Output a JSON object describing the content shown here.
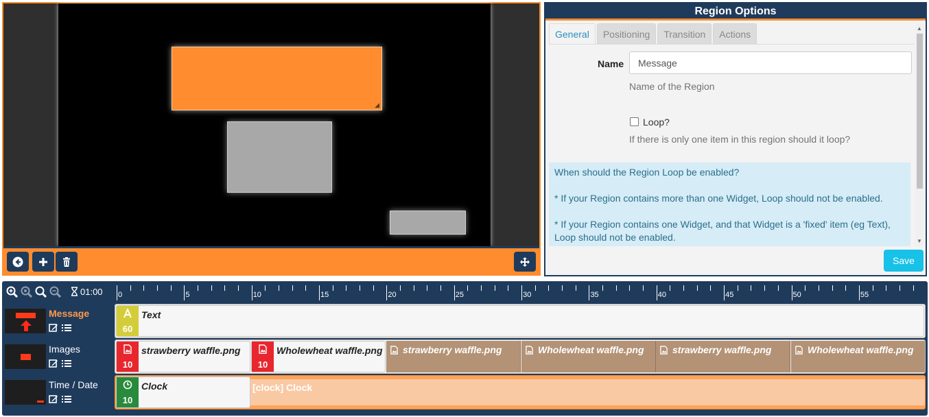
{
  "region_options": {
    "title": "Region Options",
    "tabs": [
      {
        "label": "General"
      },
      {
        "label": "Positioning"
      },
      {
        "label": "Transition"
      },
      {
        "label": "Actions"
      }
    ],
    "name_label": "Name",
    "name_value": "Message",
    "name_help": "Name of the Region",
    "loop_label": "Loop?",
    "loop_help": "If there is only one item in this region should it loop?",
    "info": [
      "When should the Region Loop be enabled?",
      "* If your Region contains more than one Widget, Loop should not be enabled.",
      "* If your Region contains one Widget, and that Widget is a 'fixed' item (eg Text), Loop should not be enabled."
    ],
    "save_label": "Save"
  },
  "colors": {
    "accent": "#ff8c2e",
    "navy": "#1f3b5c",
    "save": "#17c1e8",
    "text_widget": "#d4cd3a",
    "image_widget": "#e8262e",
    "clock_widget": "#2a8a3c"
  },
  "timeline": {
    "duration": "01:00",
    "tick_labels": [
      "0",
      "5",
      "10",
      "15",
      "20",
      "25",
      "30",
      "35",
      "40",
      "45",
      "50",
      "55"
    ],
    "rows": [
      {
        "name": "Message",
        "widgets": [
          {
            "label": "Text",
            "duration": "60",
            "icon": "text-a-icon"
          }
        ]
      },
      {
        "name": "Images",
        "widgets": [
          {
            "label": "strawberry waffle.png",
            "duration": "10",
            "icon": "image-icon"
          },
          {
            "label": "Wholewheat waffle.png",
            "duration": "10",
            "icon": "image-icon"
          }
        ],
        "loop_preview": [
          "strawberry waffle.png",
          "Wholewheat waffle.png",
          "strawberry waffle.png",
          "Wholewheat waffle.png"
        ]
      },
      {
        "name": "Time / Date",
        "widgets": [
          {
            "label": "Clock",
            "duration": "10",
            "icon": "clock-icon"
          }
        ],
        "loop_preview": "[clock] Clock"
      }
    ]
  }
}
